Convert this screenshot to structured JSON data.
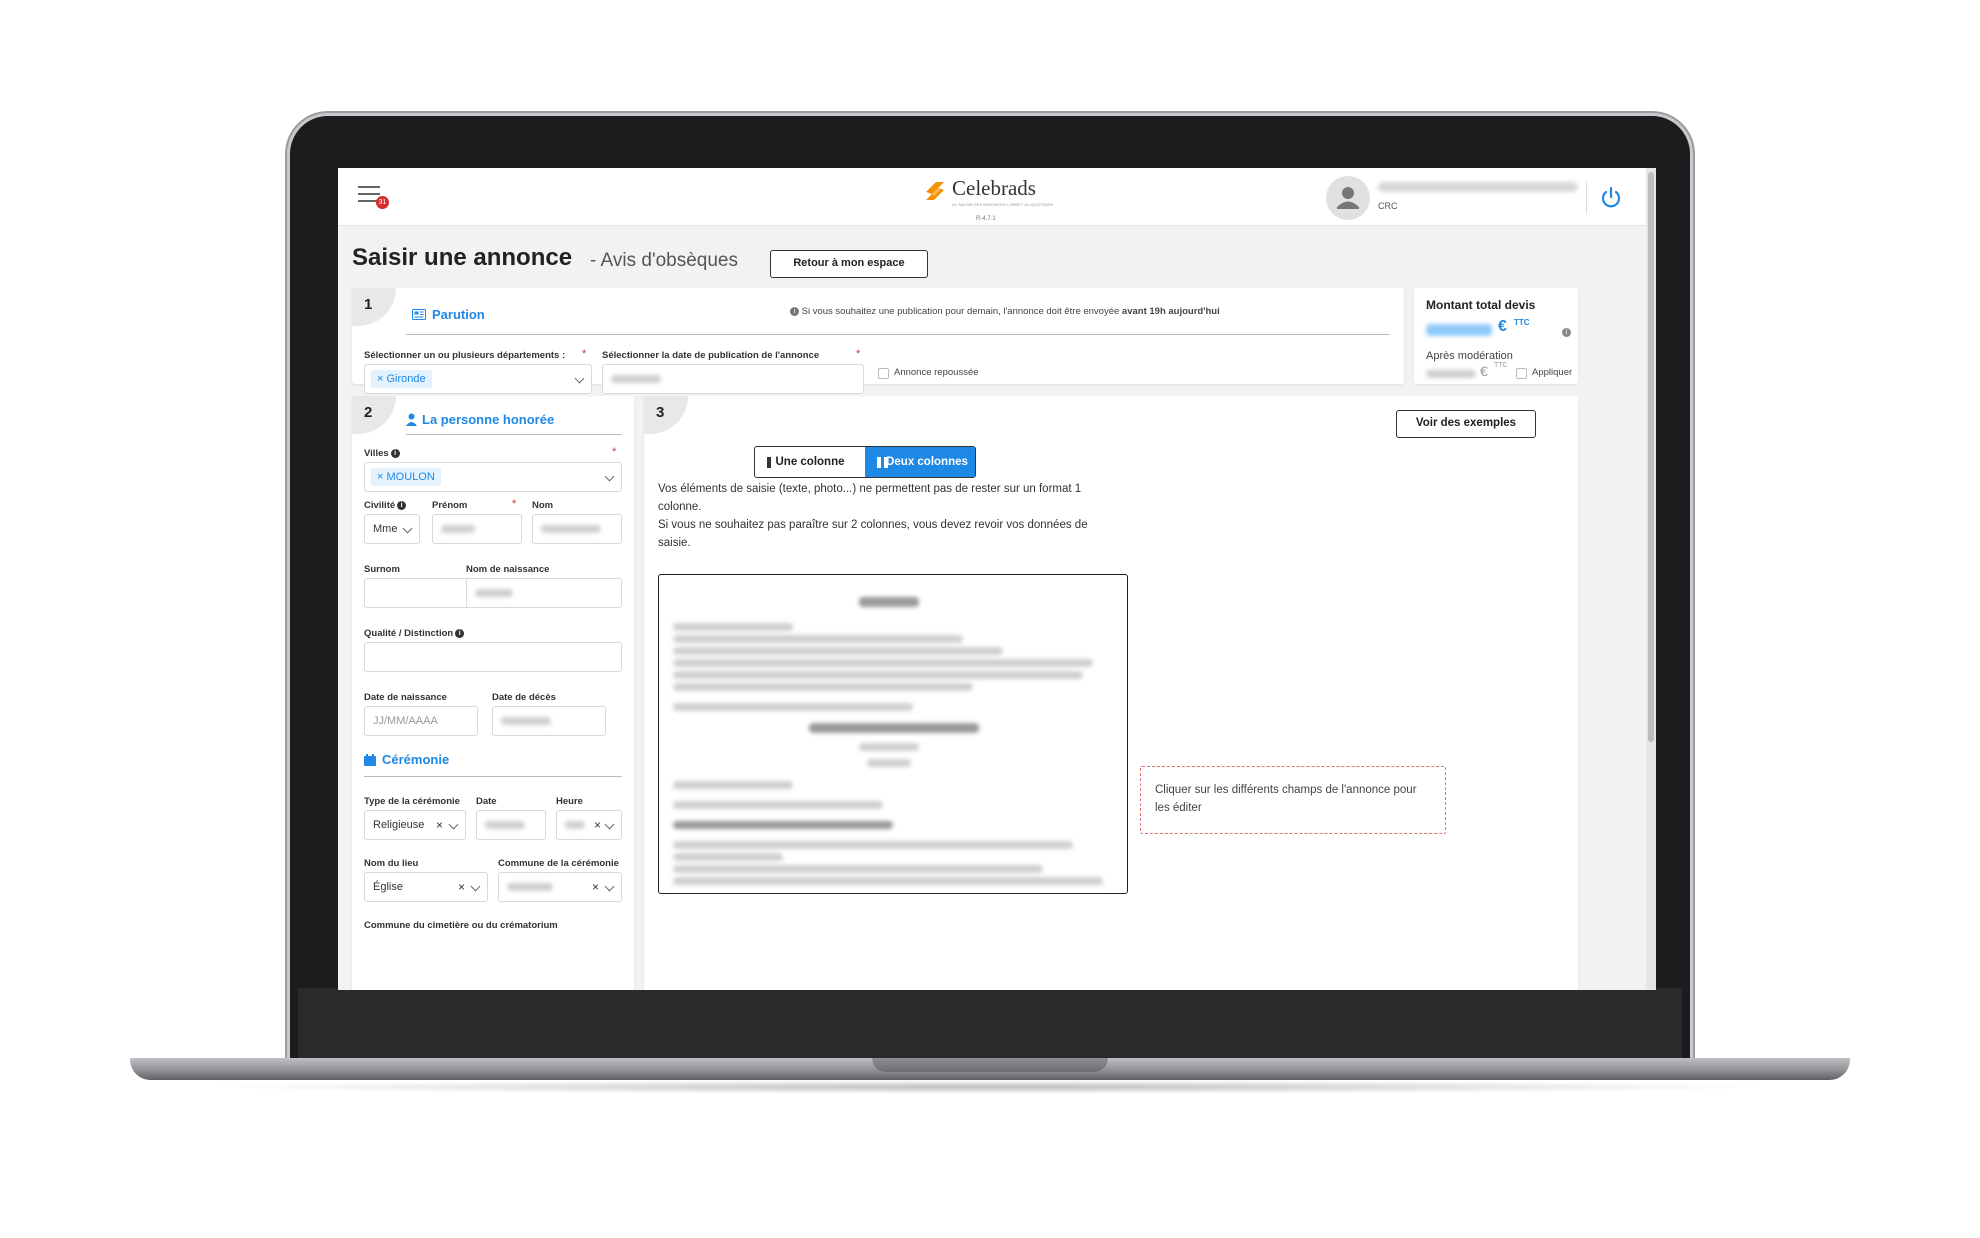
{
  "header": {
    "notification_count": "31",
    "brand_name": "Celebrads",
    "brand_tagline": "LE SAVOIR DES ANNONCES L'ARRET AU QUOTIDIEN",
    "version": "R-4.7.1",
    "user_role": "CRC"
  },
  "page": {
    "title": "Saisir une annonce",
    "subtitle": "- Avis d'obsèques",
    "back_button": "Retour à mon espace"
  },
  "step1": {
    "number": "1",
    "section_title": "Parution",
    "info_notice_prefix": "Si vous souhaitez une publication pour demain, l'annonce doit être envoyée",
    "info_notice_bold": "avant 19h aujourd'hui",
    "departments_label": "Sélectionner un ou plusieurs départements :",
    "departments_selected": "Gironde",
    "date_label": "Sélectionner la date de publication de l'annonce",
    "postponed_label": "Annonce repoussée"
  },
  "total": {
    "title": "Montant total devis",
    "currency": "€",
    "ttc": "TTC",
    "after_moderation_label": "Après modération",
    "apply_label": "Appliquer"
  },
  "step2": {
    "number": "2",
    "section_title": "La personne honorée",
    "villes_label": "Villes",
    "villes_selected": "MOULON",
    "civilite_label": "Civilité",
    "civilite_value": "Mme",
    "prenom_label": "Prénom",
    "nom_label": "Nom",
    "surnom_label": "Surnom",
    "nom_naissance_label": "Nom de naissance",
    "qualite_label": "Qualité / Distinction",
    "date_naissance_label": "Date de naissance",
    "date_naissance_placeholder": "JJ/MM/AAAA",
    "date_deces_label": "Date de décès",
    "ceremonie_title": "Cérémonie",
    "type_ceremonie_label": "Type de la cérémonie",
    "type_ceremonie_value": "Religieuse",
    "date_label": "Date",
    "heure_label": "Heure",
    "nom_lieu_label": "Nom du lieu",
    "nom_lieu_value": "Église",
    "commune_ceremonie_label": "Commune de la cérémonie",
    "commune_cimetiere_label": "Commune du cimetière ou du crématorium"
  },
  "step3": {
    "number": "3",
    "examples_button": "Voir des exemples",
    "layout_one": "Une colonne",
    "layout_two": "Deux colonnes",
    "warning_line1": "Vos éléments de saisie (texte, photo...) ne permettent pas de rester sur un format 1 colonne.",
    "warning_line2": "Si vous ne souhaitez pas paraître sur 2 colonnes, vous devez revoir vos données de saisie.",
    "hint": "Cliquer sur les différents champs de l'annonce pour les éditer"
  },
  "colors": {
    "accent": "#1e88e5",
    "brand_orange": "#f39200",
    "badge_red": "#d32f2f"
  }
}
